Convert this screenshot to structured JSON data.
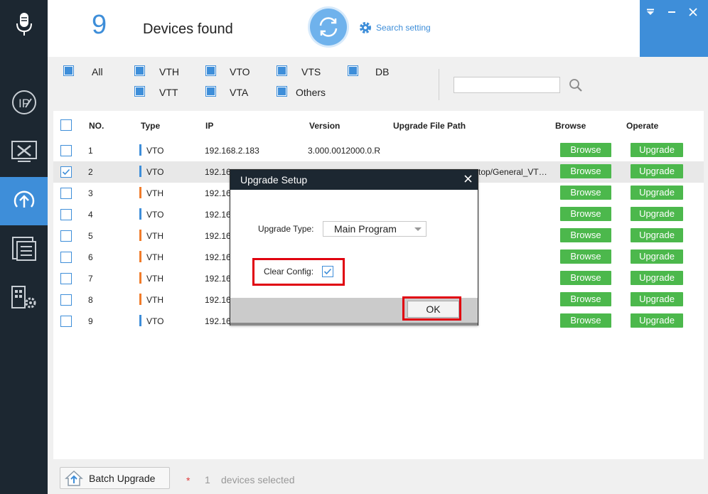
{
  "colors": {
    "accent": "#3e8ed9",
    "sidebar": "#1c2731",
    "vto": "#3e8ed9",
    "vth": "#f07c2b",
    "button_green": "#4cb84c",
    "highlight_red": "#e0000f"
  },
  "sidebar": {
    "items": [
      {
        "icon": "microphone-icon"
      },
      {
        "icon": "ip-icon"
      },
      {
        "icon": "tools-icon"
      },
      {
        "icon": "upgrade-icon",
        "active": true
      },
      {
        "icon": "document-list-icon"
      },
      {
        "icon": "building-settings-icon"
      }
    ]
  },
  "header": {
    "device_count": "9",
    "devices_found": "Devices found",
    "search_setting": "Search setting"
  },
  "window_controls": {
    "menu": "▼",
    "minimize": "—",
    "close": "✕"
  },
  "filters": {
    "all": "All",
    "items": [
      "VTH",
      "VTO",
      "VTS",
      "DB",
      "VTT",
      "VTA",
      "Others"
    ],
    "search_value": ""
  },
  "table": {
    "headers": {
      "no": "NO.",
      "type": "Type",
      "ip": "IP",
      "version": "Version",
      "path": "Upgrade File Path",
      "browse": "Browse",
      "operate": "Operate"
    },
    "browse_label": "Browse",
    "upgrade_label": "Upgrade",
    "rows": [
      {
        "no": "1",
        "type": "VTO",
        "ip": "192.168.2.183",
        "version": "3.000.0012000.0.R",
        "path": "",
        "checked": false
      },
      {
        "no": "2",
        "type": "VTO",
        "ip": "192.16",
        "version": "",
        "path": "top/General_VT…",
        "checked": true
      },
      {
        "no": "3",
        "type": "VTH",
        "ip": "192.16",
        "version": "",
        "path": "",
        "checked": false
      },
      {
        "no": "4",
        "type": "VTO",
        "ip": "192.16",
        "version": "",
        "path": "",
        "checked": false
      },
      {
        "no": "5",
        "type": "VTH",
        "ip": "192.16",
        "version": "",
        "path": "",
        "checked": false
      },
      {
        "no": "6",
        "type": "VTH",
        "ip": "192.16",
        "version": "",
        "path": "",
        "checked": false
      },
      {
        "no": "7",
        "type": "VTH",
        "ip": "192.16",
        "version": "",
        "path": "",
        "checked": false
      },
      {
        "no": "8",
        "type": "VTH",
        "ip": "192.16",
        "version": "",
        "path": "",
        "checked": false
      },
      {
        "no": "9",
        "type": "VTO",
        "ip": "192.16",
        "version": "",
        "path": "",
        "checked": false
      }
    ]
  },
  "footer": {
    "batch_upgrade": "Batch Upgrade",
    "star": "*",
    "selected_count": "1",
    "selected_text": "devices selected"
  },
  "dialog": {
    "title": "Upgrade Setup",
    "close": "✕",
    "upgrade_type_label": "Upgrade Type:",
    "upgrade_type_value": "Main Program",
    "clear_config_label": "Clear Config:",
    "clear_config_checked": true,
    "ok_label": "OK"
  }
}
